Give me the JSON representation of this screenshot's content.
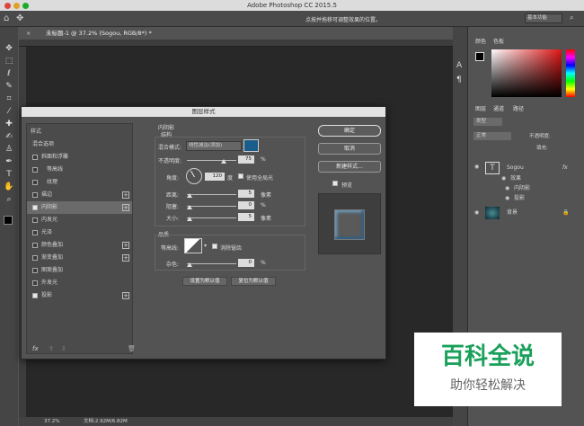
{
  "app": {
    "title": "Adobe Photoshop CC 2015.5",
    "hint": "点按并拖移可调整效果的位置。",
    "workspace": "基本功能"
  },
  "doc": {
    "tab": "未标题-1 @ 37.2% (Sogou, RGB/8*) *",
    "zoom": "37.2%",
    "info": "文档:2.92M/6.82M"
  },
  "panels": {
    "color_tabs": [
      "颜色",
      "色板"
    ],
    "layer_tabs": [
      "图层",
      "通道",
      "路径"
    ],
    "kind": "类型",
    "blend": "正常",
    "opacity": "不透明度:",
    "fill": "填充:",
    "layers": [
      {
        "name": "Sogou"
      },
      {
        "name": "效果"
      },
      {
        "name": "内阴影"
      },
      {
        "name": "投影"
      },
      {
        "name": "背景"
      }
    ]
  },
  "dialog": {
    "title": "图层样式",
    "list_header": "样式",
    "items": [
      {
        "label": "混合选项",
        "checked": false,
        "cb": false,
        "plus": false
      },
      {
        "label": "斜面和浮雕",
        "checked": false,
        "cb": true,
        "plus": false
      },
      {
        "label": "等高线",
        "checked": false,
        "cb": true,
        "plus": false
      },
      {
        "label": "纹理",
        "checked": false,
        "cb": true,
        "plus": false
      },
      {
        "label": "描边",
        "checked": false,
        "cb": true,
        "plus": true
      },
      {
        "label": "内阴影",
        "checked": true,
        "cb": true,
        "plus": true
      },
      {
        "label": "内发光",
        "checked": false,
        "cb": true,
        "plus": false
      },
      {
        "label": "光泽",
        "checked": false,
        "cb": true,
        "plus": false
      },
      {
        "label": "颜色叠加",
        "checked": false,
        "cb": true,
        "plus": true
      },
      {
        "label": "渐变叠加",
        "checked": false,
        "cb": true,
        "plus": true
      },
      {
        "label": "图案叠加",
        "checked": false,
        "cb": true,
        "plus": false
      },
      {
        "label": "外发光",
        "checked": false,
        "cb": true,
        "plus": false
      },
      {
        "label": "投影",
        "checked": true,
        "cb": true,
        "plus": true
      }
    ],
    "section": "内阴影",
    "structure": "结构",
    "quality": "品质",
    "blend_label": "混合模式:",
    "blend_value": "线性减淡(添加)",
    "opacity_label": "不透明度:",
    "opacity_value": "75",
    "opacity_level": 0.75,
    "angle_label": "角度:",
    "angle_value": "120",
    "degree": "度",
    "global_light": "使用全局光",
    "distance_label": "距离:",
    "distance_value": "5",
    "choke_label": "阻塞:",
    "choke_value": "0",
    "size_label": "大小:",
    "size_value": "5",
    "px": "像素",
    "pct": "%",
    "contour_label": "等高线:",
    "antialias": "消除锯齿",
    "noise_label": "杂色:",
    "noise_value": "0",
    "default_btn": "设置为默认值",
    "reset_btn": "复位为默认值",
    "ok": "确定",
    "cancel": "取消",
    "new_style": "新建样式...",
    "preview": "预览",
    "shadow_color": "#1a5c8a"
  },
  "watermark": {
    "line1": "百科全说",
    "line2": "助你轻松解决"
  }
}
